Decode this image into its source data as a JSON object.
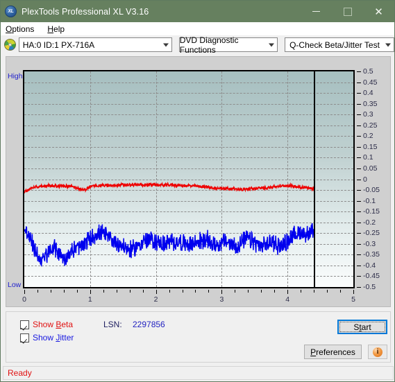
{
  "window": {
    "title": "PlexTools Professional XL V3.16",
    "icon": "plextools-xl-icon",
    "minimize_label": "",
    "maximize_label": "",
    "close_label": "✕"
  },
  "menu": {
    "items": [
      {
        "label": "Options",
        "accel": "O"
      },
      {
        "label": "Help",
        "accel": "H"
      }
    ]
  },
  "toolbar": {
    "drive_icon": "optical-disc-icon",
    "drive_combo": "HA:0 ID:1  PX-716A",
    "function_combo": "DVD Diagnostic Functions",
    "test_combo": "Q-Check Beta/Jitter Test"
  },
  "graph": {
    "high_label": "High",
    "low_label": "Low"
  },
  "controls": {
    "show_beta": {
      "label": "Show Beta",
      "checked": true,
      "color": "#e01010"
    },
    "show_jitter": {
      "label": "Show Jitter",
      "checked": true,
      "color": "#1818e0"
    },
    "lsn_label": "LSN:",
    "lsn_value": "2297856",
    "start_label": "Start",
    "preferences_label": "Preferences",
    "info_label": "i"
  },
  "status": {
    "text": "Ready"
  },
  "colors": {
    "titlebar": "#66805f",
    "beta": "#ee0000",
    "jitter": "#0000ee",
    "plot_top": "#a6bfc0",
    "plot_bottom": "#fbfdfd",
    "grid": "#8d8d8d",
    "focus": "#0078d7"
  },
  "chart_data": {
    "type": "line",
    "title": "Q-Check Beta/Jitter Test",
    "xlabel": "",
    "ylabel": "",
    "xlim": [
      0,
      5
    ],
    "ylim": [
      -0.5,
      0.5
    ],
    "xticks": [
      0,
      1,
      2,
      3,
      4,
      5
    ],
    "yticks": [
      0.5,
      0.45,
      0.4,
      0.35,
      0.3,
      0.25,
      0.2,
      0.15,
      0.1,
      0.05,
      0,
      -0.05,
      -0.1,
      -0.15,
      -0.2,
      -0.25,
      -0.3,
      -0.35,
      -0.4,
      -0.45,
      -0.5
    ],
    "ytick_labels": [
      "0.5",
      "0.45",
      "0.4",
      "0.35",
      "0.3",
      "0.25",
      "0.2",
      "0.15",
      "0.1",
      "0.05",
      "0",
      "-0.05",
      "-0.1",
      "-0.15",
      "-0.2",
      "-0.25",
      "-0.3",
      "-0.35",
      "-0.4",
      "-0.45",
      "-0.5"
    ],
    "grid": true,
    "grid_style": "dashed",
    "legend": [
      "Show Beta",
      "Show Jitter"
    ],
    "legend_position": "below-left",
    "data_end_marker_x": 4.4,
    "axis_left_labels": [
      "High",
      "Low"
    ],
    "series": [
      {
        "name": "Beta",
        "color": "#ee0000",
        "x": [
          0.0,
          0.05,
          0.1,
          0.15,
          0.2,
          0.25,
          0.3,
          0.35,
          0.4,
          0.45,
          0.5,
          0.55,
          0.6,
          0.65,
          0.7,
          0.75,
          0.8,
          0.85,
          0.9,
          0.95,
          1.0,
          1.05,
          1.1,
          1.15,
          1.2,
          1.25,
          1.3,
          1.35,
          1.4,
          1.45,
          1.5,
          1.55,
          1.6,
          1.65,
          1.7,
          1.75,
          1.8,
          1.85,
          1.9,
          1.95,
          2.0,
          2.05,
          2.1,
          2.15,
          2.2,
          2.25,
          2.3,
          2.35,
          2.4,
          2.45,
          2.5,
          2.55,
          2.6,
          2.65,
          2.7,
          2.75,
          2.8,
          2.85,
          2.9,
          2.95,
          3.0,
          3.05,
          3.1,
          3.15,
          3.2,
          3.25,
          3.3,
          3.35,
          3.4,
          3.45,
          3.5,
          3.55,
          3.6,
          3.65,
          3.7,
          3.75,
          3.8,
          3.85,
          3.9,
          3.95,
          4.0,
          4.05,
          4.1,
          4.15,
          4.2,
          4.25,
          4.3,
          4.35,
          4.4
        ],
        "y": [
          -0.06,
          -0.05,
          -0.042,
          -0.037,
          -0.034,
          -0.033,
          -0.031,
          -0.03,
          -0.031,
          -0.033,
          -0.032,
          -0.03,
          -0.031,
          -0.033,
          -0.034,
          -0.036,
          -0.04,
          -0.046,
          -0.052,
          -0.044,
          -0.035,
          -0.031,
          -0.03,
          -0.029,
          -0.028,
          -0.029,
          -0.03,
          -0.029,
          -0.028,
          -0.027,
          -0.026,
          -0.026,
          -0.027,
          -0.027,
          -0.026,
          -0.025,
          -0.026,
          -0.027,
          -0.026,
          -0.025,
          -0.026,
          -0.027,
          -0.028,
          -0.027,
          -0.026,
          -0.027,
          -0.028,
          -0.029,
          -0.03,
          -0.031,
          -0.03,
          -0.031,
          -0.032,
          -0.033,
          -0.034,
          -0.035,
          -0.036,
          -0.04,
          -0.044,
          -0.042,
          -0.041,
          -0.042,
          -0.043,
          -0.044,
          -0.045,
          -0.046,
          -0.048,
          -0.047,
          -0.046,
          -0.044,
          -0.043,
          -0.042,
          -0.041,
          -0.04,
          -0.038,
          -0.036,
          -0.034,
          -0.033,
          -0.032,
          -0.031,
          -0.03,
          -0.031,
          -0.033,
          -0.035,
          -0.036,
          -0.038,
          -0.04,
          -0.042,
          -0.044
        ],
        "noise_amplitude": 0.006
      },
      {
        "name": "Jitter",
        "color": "#0000ee",
        "x": [
          0.0,
          0.05,
          0.1,
          0.15,
          0.2,
          0.25,
          0.3,
          0.35,
          0.4,
          0.45,
          0.5,
          0.55,
          0.6,
          0.65,
          0.7,
          0.75,
          0.8,
          0.85,
          0.9,
          0.95,
          1.0,
          1.05,
          1.1,
          1.15,
          1.2,
          1.25,
          1.3,
          1.35,
          1.4,
          1.45,
          1.5,
          1.55,
          1.6,
          1.65,
          1.7,
          1.75,
          1.8,
          1.85,
          1.9,
          1.95,
          2.0,
          2.05,
          2.1,
          2.15,
          2.2,
          2.25,
          2.3,
          2.35,
          2.4,
          2.45,
          2.5,
          2.55,
          2.6,
          2.65,
          2.7,
          2.75,
          2.8,
          2.85,
          2.9,
          2.95,
          3.0,
          3.05,
          3.1,
          3.15,
          3.2,
          3.25,
          3.3,
          3.35,
          3.4,
          3.45,
          3.5,
          3.55,
          3.6,
          3.65,
          3.7,
          3.75,
          3.8,
          3.85,
          3.9,
          3.95,
          4.0,
          4.05,
          4.1,
          4.15,
          4.2,
          4.25,
          4.3,
          4.35,
          4.4
        ],
        "y": [
          -0.225,
          -0.255,
          -0.285,
          -0.32,
          -0.35,
          -0.375,
          -0.37,
          -0.345,
          -0.33,
          -0.32,
          -0.33,
          -0.35,
          -0.37,
          -0.36,
          -0.34,
          -0.325,
          -0.32,
          -0.315,
          -0.305,
          -0.29,
          -0.275,
          -0.265,
          -0.255,
          -0.25,
          -0.255,
          -0.265,
          -0.275,
          -0.285,
          -0.295,
          -0.3,
          -0.31,
          -0.32,
          -0.33,
          -0.325,
          -0.315,
          -0.3,
          -0.29,
          -0.285,
          -0.28,
          -0.285,
          -0.29,
          -0.295,
          -0.3,
          -0.298,
          -0.295,
          -0.292,
          -0.29,
          -0.292,
          -0.295,
          -0.3,
          -0.305,
          -0.3,
          -0.295,
          -0.29,
          -0.285,
          -0.28,
          -0.285,
          -0.295,
          -0.305,
          -0.3,
          -0.295,
          -0.29,
          -0.295,
          -0.3,
          -0.31,
          -0.305,
          -0.295,
          -0.285,
          -0.275,
          -0.285,
          -0.295,
          -0.305,
          -0.315,
          -0.31,
          -0.3,
          -0.29,
          -0.295,
          -0.305,
          -0.31,
          -0.3,
          -0.285,
          -0.27,
          -0.26,
          -0.25,
          -0.245,
          -0.25,
          -0.255,
          -0.248,
          -0.24
        ],
        "noise_amplitude": 0.035
      }
    ]
  }
}
